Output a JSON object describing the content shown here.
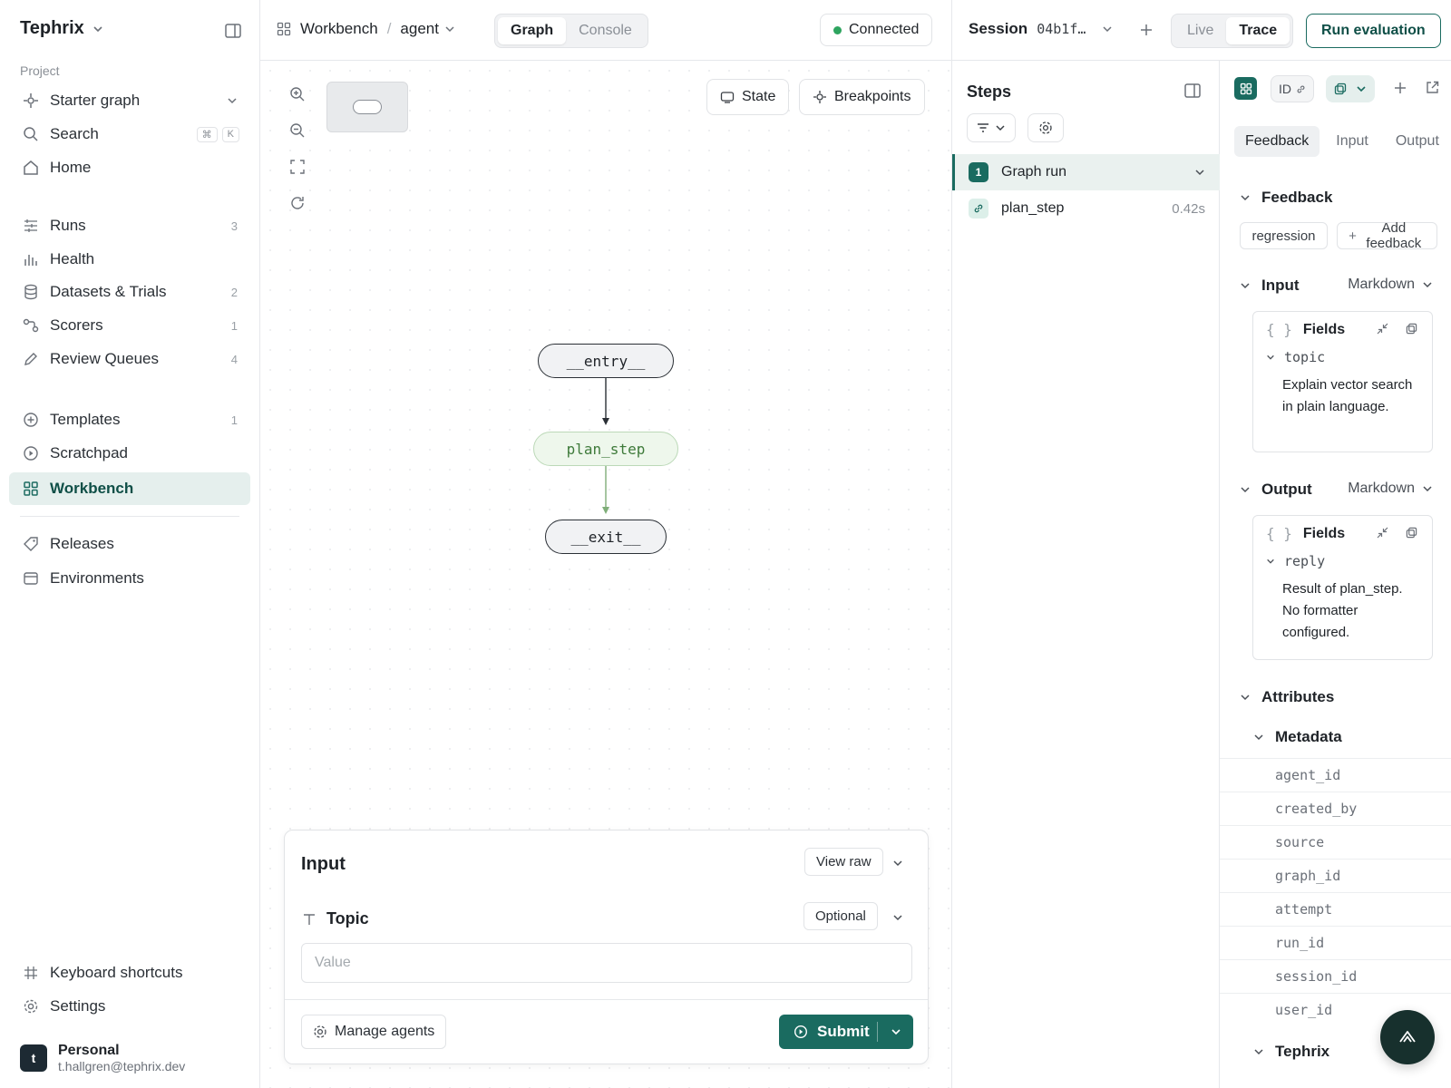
{
  "sidebar": {
    "brand": "Tephrix",
    "section_label": "Project",
    "project_selector": "Starter graph",
    "search": {
      "label": "Search",
      "kbd": [
        "⌘",
        "K"
      ]
    },
    "home": "Home",
    "items_group1": [
      {
        "label": "Runs",
        "count": "3",
        "icon": "runs-icon"
      },
      {
        "label": "Health",
        "count": "",
        "icon": "health-icon"
      },
      {
        "label": "Datasets & Trials",
        "count": "2",
        "icon": "database-icon"
      },
      {
        "label": "Scorers",
        "count": "1",
        "icon": "scorers-icon"
      },
      {
        "label": "Review Queues",
        "count": "4",
        "icon": "pencil-icon"
      }
    ],
    "items_group2": [
      {
        "label": "Templates",
        "count": "1",
        "icon": "plus-circle-icon"
      },
      {
        "label": "Scratchpad",
        "count": "",
        "icon": "play-circle-icon"
      },
      {
        "label": "Workbench",
        "count": "",
        "icon": "grid-icon",
        "active": true
      }
    ],
    "items_group3": [
      {
        "label": "Releases",
        "icon": "tag-icon"
      },
      {
        "label": "Environments",
        "icon": "window-icon"
      }
    ],
    "footer": {
      "shortcuts": "Keyboard shortcuts",
      "settings": "Settings",
      "profile_name": "Personal",
      "profile_email": "t.hallgren@tephrix.dev",
      "avatar_letter": "t"
    }
  },
  "topbar": {
    "breadcrumb_root": "Workbench",
    "breadcrumb_sep": "/",
    "breadcrumb_agent": "agent",
    "view_tabs": [
      "Graph",
      "Console"
    ],
    "active_view": "Graph",
    "status": "Connected"
  },
  "canvas": {
    "state_button": "State",
    "breakpoints_button": "Breakpoints",
    "nodes": {
      "entry": "__entry__",
      "step": "plan_step",
      "exit": "__exit__"
    }
  },
  "input_panel": {
    "title": "Input",
    "view_raw": "View raw",
    "field_label": "Topic",
    "optional": "Optional",
    "value_placeholder": "Value",
    "manage_agents": "Manage agents",
    "submit": "Submit"
  },
  "session": {
    "label": "Session",
    "id": "04b1f…",
    "modes": [
      "Live",
      "Trace"
    ],
    "active_mode": "Trace",
    "run_evaluation": "Run evaluation"
  },
  "steps": {
    "title": "Steps",
    "rows": [
      {
        "num": "1",
        "label": "Graph run",
        "time": ""
      },
      {
        "num": "",
        "label": "plan_step",
        "time": "0.42s"
      }
    ]
  },
  "detail": {
    "id_label": "ID",
    "tabs": [
      "Feedback",
      "Input",
      "Output"
    ],
    "active_tab": "Feedback",
    "feedback": {
      "title": "Feedback",
      "chip": "regression",
      "add": "Add feedback"
    },
    "input": {
      "title": "Input",
      "format": "Markdown",
      "fields_label": "Fields",
      "key": "topic",
      "value": "Explain vector search in plain language."
    },
    "output": {
      "title": "Output",
      "format": "Markdown",
      "fields_label": "Fields",
      "key": "reply",
      "value": "Result of plan_step. No formatter configured."
    },
    "attributes_title": "Attributes",
    "metadata_title": "Metadata",
    "metadata_keys": [
      "agent_id",
      "created_by",
      "source",
      "graph_id",
      "attempt",
      "run_id",
      "session_id",
      "user_id"
    ],
    "tephrix_title": "Tephrix"
  },
  "colors": {
    "accent": "#1a6b60",
    "active_bg": "#e5efed",
    "status_green": "#2ea45f"
  }
}
